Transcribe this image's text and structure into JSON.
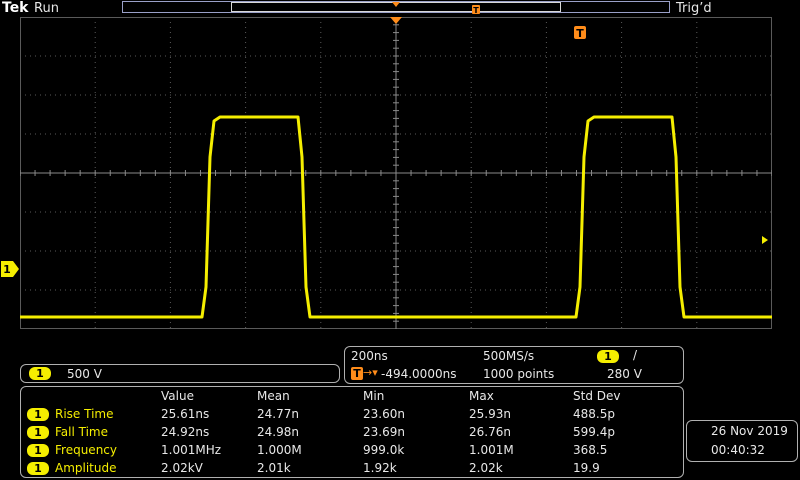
{
  "header": {
    "brand": "Tek",
    "run_state": "Run",
    "trigger_state": "Trig’d"
  },
  "colors": {
    "channel1": "#f5ee00",
    "trigger_marker": "#ff8c1a",
    "grid": "#5a5a5a",
    "background": "#000000"
  },
  "waveform": {
    "channel": "1",
    "trigger_marker_label": "T"
  },
  "vertical": {
    "channel": "1",
    "scale": "500 V"
  },
  "horizontal": {
    "time_per_div": "200ns",
    "sample_rate": "500MS/s",
    "trigger_channel": "1",
    "trigger_slope_glyph": "/",
    "trigger_label": "T",
    "trigger_arrow": "→▾",
    "delay": "-494.0000ns",
    "record_length": "1000 points",
    "trigger_level": "280 V"
  },
  "measurements": {
    "headers": [
      "Value",
      "Mean",
      "Min",
      "Max",
      "Std Dev"
    ],
    "rows": [
      {
        "channel": "1",
        "name": "Rise Time",
        "value": "25.61ns",
        "mean": "24.77n",
        "min": "23.60n",
        "max": "25.93n",
        "std": "488.5p"
      },
      {
        "channel": "1",
        "name": "Fall Time",
        "value": "24.92ns",
        "mean": "24.98n",
        "min": "23.69n",
        "max": "26.76n",
        "std": "599.4p"
      },
      {
        "channel": "1",
        "name": "Frequency",
        "value": "1.001MHz",
        "mean": "1.000M",
        "min": "999.0k",
        "max": "1.001M",
        "std": "368.5"
      },
      {
        "channel": "1",
        "name": "Amplitude",
        "value": "2.02kV",
        "mean": "2.01k",
        "min": "1.92k",
        "max": "2.02k",
        "std": "19.9"
      }
    ]
  },
  "datetime": {
    "date": "26 Nov 2019",
    "time": "00:40:32"
  }
}
